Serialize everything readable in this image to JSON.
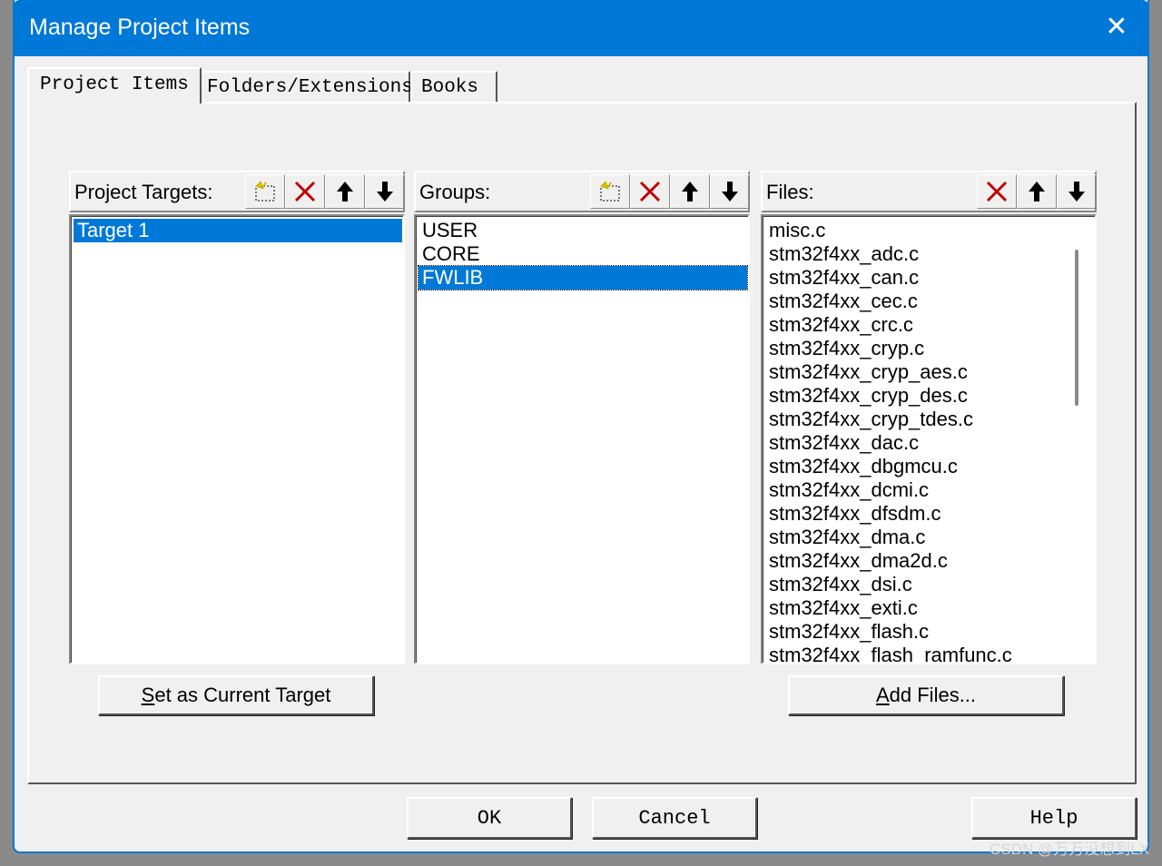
{
  "window": {
    "title": "Manage Project Items",
    "close_glyph": "✕"
  },
  "tabs": [
    {
      "label": "Project Items",
      "active": true
    },
    {
      "label": "Folders/Extensions",
      "active": false
    },
    {
      "label": "Books",
      "active": false
    }
  ],
  "targets": {
    "label": "Project Targets:",
    "items": [
      {
        "text": "Target 1",
        "selected": true
      }
    ],
    "toolbar": [
      "new-icon",
      "delete-icon",
      "move-up-icon",
      "move-down-icon"
    ]
  },
  "groups": {
    "label": "Groups:",
    "items": [
      {
        "text": "USER",
        "selected": false
      },
      {
        "text": "CORE",
        "selected": false
      },
      {
        "text": "FWLIB",
        "selected": true
      }
    ],
    "toolbar": [
      "new-icon",
      "delete-icon",
      "move-up-icon",
      "move-down-icon"
    ]
  },
  "files": {
    "label": "Files:",
    "items": [
      "misc.c",
      "stm32f4xx_adc.c",
      "stm32f4xx_can.c",
      "stm32f4xx_cec.c",
      "stm32f4xx_crc.c",
      "stm32f4xx_cryp.c",
      "stm32f4xx_cryp_aes.c",
      "stm32f4xx_cryp_des.c",
      "stm32f4xx_cryp_tdes.c",
      "stm32f4xx_dac.c",
      "stm32f4xx_dbgmcu.c",
      "stm32f4xx_dcmi.c",
      "stm32f4xx_dfsdm.c",
      "stm32f4xx_dma.c",
      "stm32f4xx_dma2d.c",
      "stm32f4xx_dsi.c",
      "stm32f4xx_exti.c",
      "stm32f4xx_flash.c",
      "stm32f4xx_flash_ramfunc.c"
    ],
    "toolbar": [
      "delete-icon",
      "move-up-icon",
      "move-down-icon"
    ]
  },
  "buttons": {
    "set_current_u": "S",
    "set_current_rest": "et as Current Target",
    "add_files_u": "A",
    "add_files_rest": "dd Files...",
    "ok": "OK",
    "cancel": "Cancel",
    "help": "Help"
  },
  "colors": {
    "accent": "#0078d7",
    "delete": "#c00000"
  },
  "watermark": "CSDN @万万没想到LX"
}
